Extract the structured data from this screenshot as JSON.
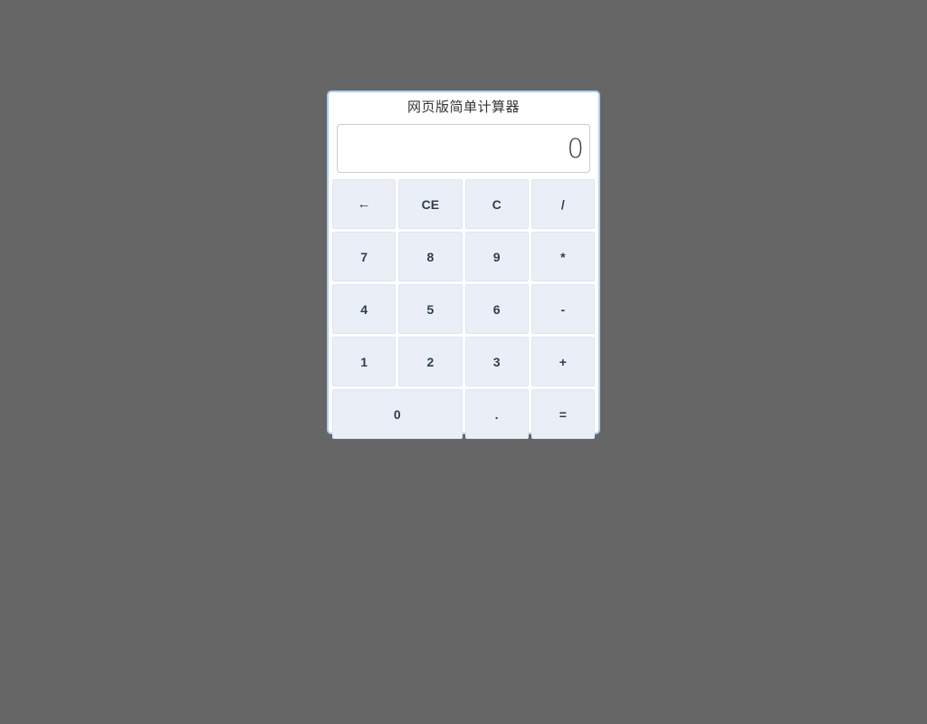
{
  "page": {
    "background_color": "#666666"
  },
  "calculator": {
    "title": "网页版简单计算器",
    "panel_border_color": "#a9cded",
    "display": {
      "value": "0",
      "placeholder": "0",
      "text_color": "#3a3a3a"
    },
    "key_text_color": "#2c3e50",
    "key_background_color": "#eaeff7",
    "keys": [
      {
        "label": "←",
        "name": "backspace-key",
        "type": "action",
        "span": 1
      },
      {
        "label": "CE",
        "name": "clear-entry-key",
        "type": "action",
        "span": 1
      },
      {
        "label": "C",
        "name": "clear-key",
        "type": "action",
        "span": 1
      },
      {
        "label": "/",
        "name": "divide-key",
        "type": "operator",
        "span": 1
      },
      {
        "label": "7",
        "name": "digit-7-key",
        "type": "digit",
        "span": 1
      },
      {
        "label": "8",
        "name": "digit-8-key",
        "type": "digit",
        "span": 1
      },
      {
        "label": "9",
        "name": "digit-9-key",
        "type": "digit",
        "span": 1
      },
      {
        "label": "*",
        "name": "multiply-key",
        "type": "operator",
        "span": 1
      },
      {
        "label": "4",
        "name": "digit-4-key",
        "type": "digit",
        "span": 1
      },
      {
        "label": "5",
        "name": "digit-5-key",
        "type": "digit",
        "span": 1
      },
      {
        "label": "6",
        "name": "digit-6-key",
        "type": "digit",
        "span": 1
      },
      {
        "label": "-",
        "name": "subtract-key",
        "type": "operator",
        "span": 1
      },
      {
        "label": "1",
        "name": "digit-1-key",
        "type": "digit",
        "span": 1
      },
      {
        "label": "2",
        "name": "digit-2-key",
        "type": "digit",
        "span": 1
      },
      {
        "label": "3",
        "name": "digit-3-key",
        "type": "digit",
        "span": 1
      },
      {
        "label": "+",
        "name": "add-key",
        "type": "operator",
        "span": 1
      },
      {
        "label": "0",
        "name": "digit-0-key",
        "type": "digit",
        "span": 2
      },
      {
        "label": ".",
        "name": "decimal-point-key",
        "type": "digit",
        "span": 1
      },
      {
        "label": "=",
        "name": "equals-key",
        "type": "operator",
        "span": 1
      }
    ]
  }
}
